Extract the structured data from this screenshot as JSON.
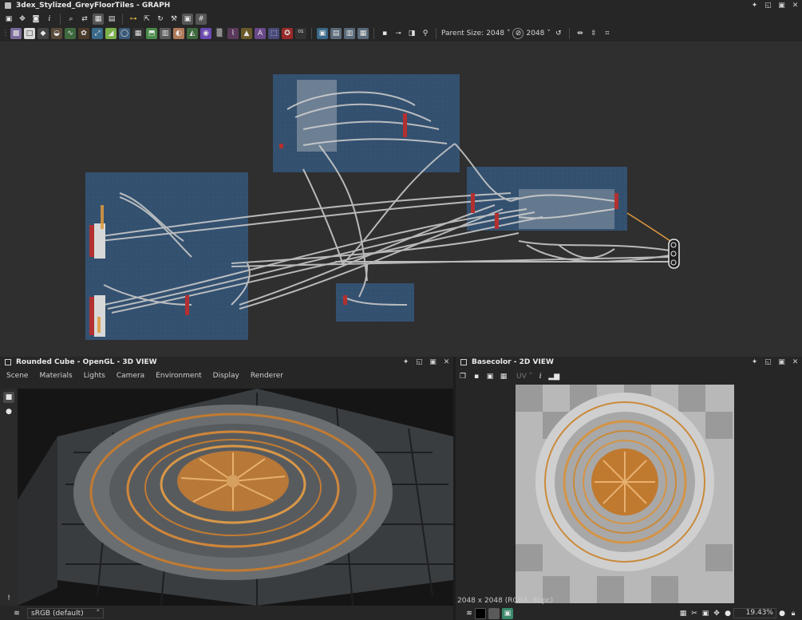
{
  "graph": {
    "title": "3dex_Stylized_GreyFloorTiles - GRAPH",
    "parent_size_label": "Parent Size:",
    "parent_size_value": "2048",
    "output_size_value": "2048",
    "icons": [
      "frame-icon",
      "fit-icon",
      "camera-icon",
      "info-icon",
      "search-icon",
      "connection-icon",
      "layout-icon",
      "comment-icon",
      "link-icon",
      "hierarchy-icon",
      "refresh-icon",
      "wrench-icon",
      "snapshot-icon",
      "grid-icon"
    ],
    "node_icons": [
      "bitmap-node-icon",
      "uniform-node-icon",
      "levels-node-icon",
      "blend-node-icon",
      "curve-node-icon",
      "warp-node-icon",
      "transform-node-icon",
      "gradient-node-icon",
      "tile-node-icon",
      "emboss-node-icon",
      "shape-node-icon",
      "histogram-node-icon",
      "normal-node-icon",
      "noise-node-icon",
      "text-node-icon",
      "bevel-node-icon",
      "distance-node-icon",
      "output-node-icon"
    ]
  },
  "view3d": {
    "title": "Rounded Cube - OpenGL - 3D VIEW",
    "menu": [
      "Scene",
      "Materials",
      "Lights",
      "Camera",
      "Environment",
      "Display",
      "Renderer"
    ],
    "colorspace": "sRGB (default)"
  },
  "view2d": {
    "title": "Basecolor - 2D VIEW",
    "uv_label": "UV",
    "status": "2048 x 2048 (RGBA, 8bpc)",
    "zoom": "19.43%"
  },
  "colors": {
    "panel": "#262626",
    "graph_bg": "#2f2f2f",
    "frame": "#33506f",
    "wire": "#c8c8c8",
    "accent": "#e09a3c"
  }
}
